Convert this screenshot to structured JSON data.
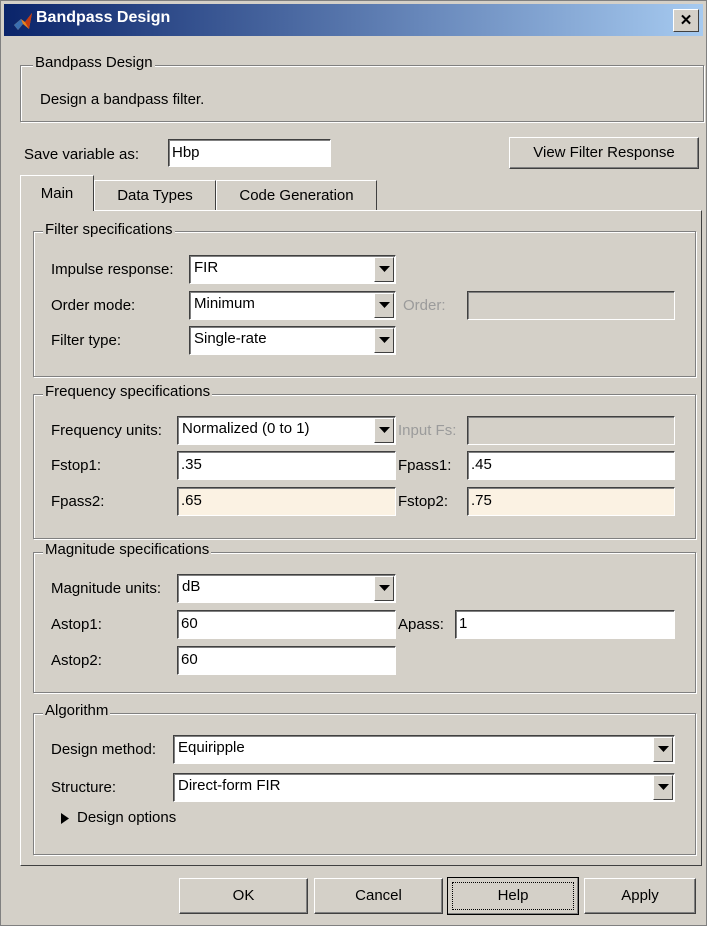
{
  "window": {
    "title": "Bandpass Design",
    "close_glyph": "✕",
    "icon": "matlab-icon"
  },
  "header": {
    "group_label": "Bandpass Design",
    "description": "Design a bandpass filter."
  },
  "save": {
    "label": "Save variable as:",
    "value": "Hbp",
    "view_button": "View Filter Response"
  },
  "tabs": [
    {
      "label": "Main",
      "selected": true
    },
    {
      "label": "Data Types",
      "selected": false
    },
    {
      "label": "Code Generation",
      "selected": false
    }
  ],
  "filter_spec": {
    "group_label": "Filter specifications",
    "impulse_label": "Impulse response:",
    "impulse_value": "FIR",
    "order_mode_label": "Order mode:",
    "order_mode_value": "Minimum",
    "order_label": "Order:",
    "order_value": "",
    "filter_type_label": "Filter type:",
    "filter_type_value": "Single-rate"
  },
  "freq_spec": {
    "group_label": "Frequency specifications",
    "units_label": "Frequency units:",
    "units_value": "Normalized (0 to 1)",
    "input_fs_label": "Input Fs:",
    "input_fs_value": "",
    "fstop1_label": "Fstop1:",
    "fstop1_value": ".35",
    "fpass1_label": "Fpass1:",
    "fpass1_value": ".45",
    "fpass2_label": "Fpass2:",
    "fpass2_value": ".65",
    "fstop2_label": "Fstop2:",
    "fstop2_value": ".75"
  },
  "mag_spec": {
    "group_label": "Magnitude specifications",
    "units_label": "Magnitude units:",
    "units_value": "dB",
    "astop1_label": "Astop1:",
    "astop1_value": "60",
    "apass_label": "Apass:",
    "apass_value": "1",
    "astop2_label": "Astop2:",
    "astop2_value": "60"
  },
  "algorithm": {
    "group_label": "Algorithm",
    "method_label": "Design method:",
    "method_value": "Equiripple",
    "structure_label": "Structure:",
    "structure_value": "Direct-form FIR",
    "options_label": "Design options"
  },
  "buttons": {
    "ok": "OK",
    "cancel": "Cancel",
    "help": "Help",
    "apply": "Apply"
  },
  "colors": {
    "face": "#d4d0c8",
    "highlight_field": "#fbf2e3",
    "title_start": "#0a246a",
    "title_end": "#a6caf0"
  }
}
